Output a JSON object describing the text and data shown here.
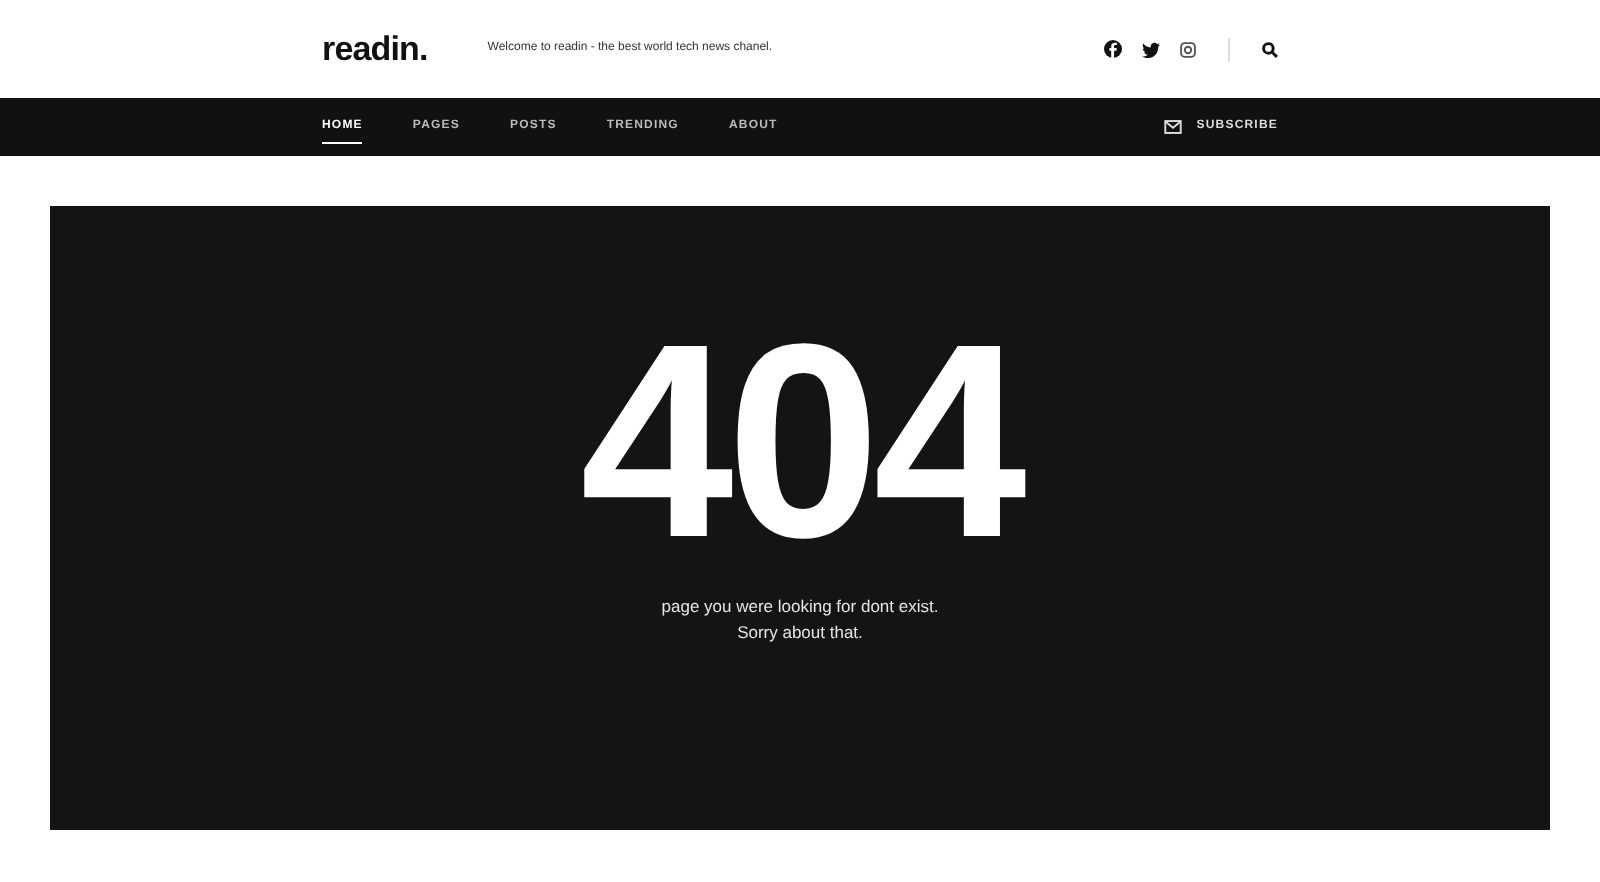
{
  "header": {
    "logo": "readin.",
    "tagline": "Welcome to readin - the best world tech news chanel."
  },
  "nav": {
    "items": [
      {
        "label": "HOME",
        "selected": true
      },
      {
        "label": "PAGES",
        "selected": false
      },
      {
        "label": "POSTS",
        "selected": false
      },
      {
        "label": "TRENDING",
        "selected": false
      },
      {
        "label": "ABOUT",
        "selected": false
      }
    ],
    "subscribe": "SUBSCRIBE"
  },
  "error": {
    "code": "404",
    "lines": [
      "page you were looking for dont exist.",
      "Sorry about that."
    ]
  }
}
